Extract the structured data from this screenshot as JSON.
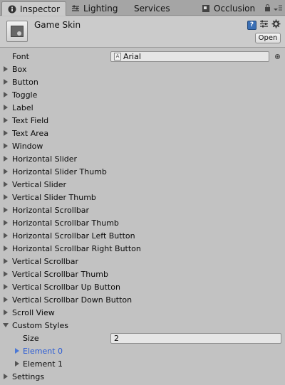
{
  "tabs": [
    {
      "label": "Inspector",
      "icon": "info-icon"
    },
    {
      "label": "Lighting",
      "icon": "lighting-icon"
    },
    {
      "label": "Services",
      "icon": ""
    },
    {
      "label": "Occlusion",
      "icon": "occlusion-icon"
    }
  ],
  "header": {
    "title": "Game Skin",
    "open_label": "Open"
  },
  "font_row": {
    "label": "Font",
    "value": "Arial"
  },
  "items": [
    "Box",
    "Button",
    "Toggle",
    "Label",
    "Text Field",
    "Text Area",
    "Window",
    "Horizontal Slider",
    "Horizontal Slider Thumb",
    "Vertical Slider",
    "Vertical Slider Thumb",
    "Horizontal Scrollbar",
    "Horizontal Scrollbar Thumb",
    "Horizontal Scrollbar Left Button",
    "Horizontal Scrollbar Right Button",
    "Vertical Scrollbar",
    "Vertical Scrollbar Thumb",
    "Vertical Scrollbar Up Button",
    "Vertical Scrollbar Down Button",
    "Scroll View"
  ],
  "custom_styles": {
    "label": "Custom Styles",
    "size_label": "Size",
    "size_value": "2",
    "elements": [
      "Element 0",
      "Element 1"
    ]
  },
  "settings_label": "Settings",
  "colors": {
    "background": "#c2c2c2",
    "tabbar": "#a5a5a5",
    "selected_text": "#2a5bd4"
  }
}
